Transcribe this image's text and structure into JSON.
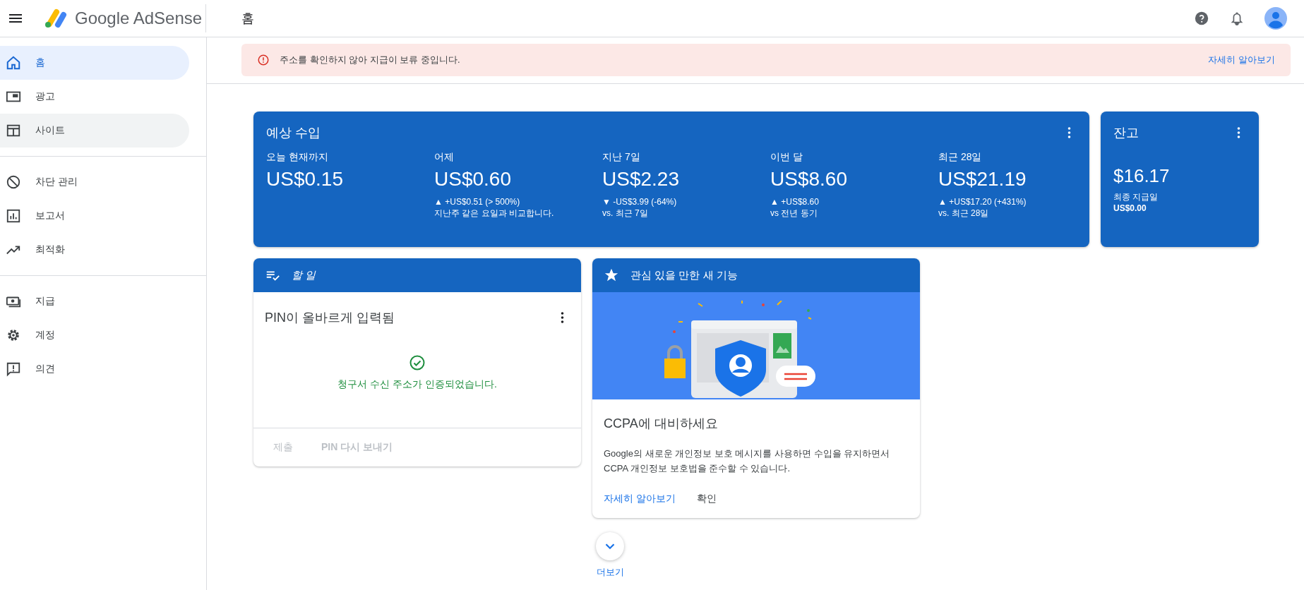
{
  "app": {
    "name": "Google AdSense",
    "page_title": "홈"
  },
  "sidebar": {
    "groups": [
      {
        "items": [
          {
            "label": "홈",
            "selected": true,
            "hovered": false
          },
          {
            "label": "광고",
            "selected": false,
            "hovered": false
          },
          {
            "label": "사이트",
            "selected": false,
            "hovered": true
          }
        ]
      },
      {
        "items": [
          {
            "label": "차단 관리",
            "selected": false,
            "hovered": false
          },
          {
            "label": "보고서",
            "selected": false,
            "hovered": false
          },
          {
            "label": "최적화",
            "selected": false,
            "hovered": false
          }
        ]
      },
      {
        "items": [
          {
            "label": "지급",
            "selected": false,
            "hovered": false
          },
          {
            "label": "계정",
            "selected": false,
            "hovered": false
          },
          {
            "label": "의견",
            "selected": false,
            "hovered": false
          }
        ]
      }
    ]
  },
  "alert": {
    "message": "주소를 확인하지 않아 지급이 보류 중입니다.",
    "link": "자세히 알아보기"
  },
  "earnings": {
    "title": "예상 수입",
    "metrics": [
      {
        "label": "오늘 현재까지",
        "value": "US$0.15"
      },
      {
        "label": "어제",
        "value": "US$0.60",
        "change": "▲ +US$0.51 (> 500%)",
        "note": "지난주 같은 요일과 비교합니다."
      },
      {
        "label": "지난 7일",
        "value": "US$2.23",
        "change": "▼ -US$3.99 (-64%)",
        "note": "vs. 최근 7일"
      },
      {
        "label": "이번 달",
        "value": "US$8.60",
        "change": "▲ +US$8.60",
        "note": "vs 전년 동기"
      },
      {
        "label": "최근 28일",
        "value": "US$21.19",
        "change": "▲ +US$17.20 (+431%)",
        "note": "vs. 최근 28일"
      }
    ]
  },
  "balance": {
    "title": "잔고",
    "value": "$16.17",
    "label": "최종 지급일",
    "amount": "US$0.00"
  },
  "tasks": {
    "title": "할 일",
    "item_title": "PIN이 올바르게 입력됨",
    "status": "청구서 수신 주소가 인증되었습니다.",
    "actions": [
      {
        "label": "제출",
        "disabled": true
      },
      {
        "label": "PIN 다시 보내기",
        "disabled": true
      }
    ]
  },
  "feature": {
    "title": "관심 있을 만한 새 기능",
    "heading": "CCPA에 대비하세요",
    "body": "Google의 새로운 개인정보 보호 메시지를 사용하면 수입을 유지하면서 CCPA 개인정보 보호법을 준수할 수 있습니다.",
    "actions": [
      {
        "label": "자세히 알아보기",
        "kind": "link"
      },
      {
        "label": "확인",
        "kind": "plain"
      }
    ]
  },
  "more": {
    "label": "더보기"
  }
}
